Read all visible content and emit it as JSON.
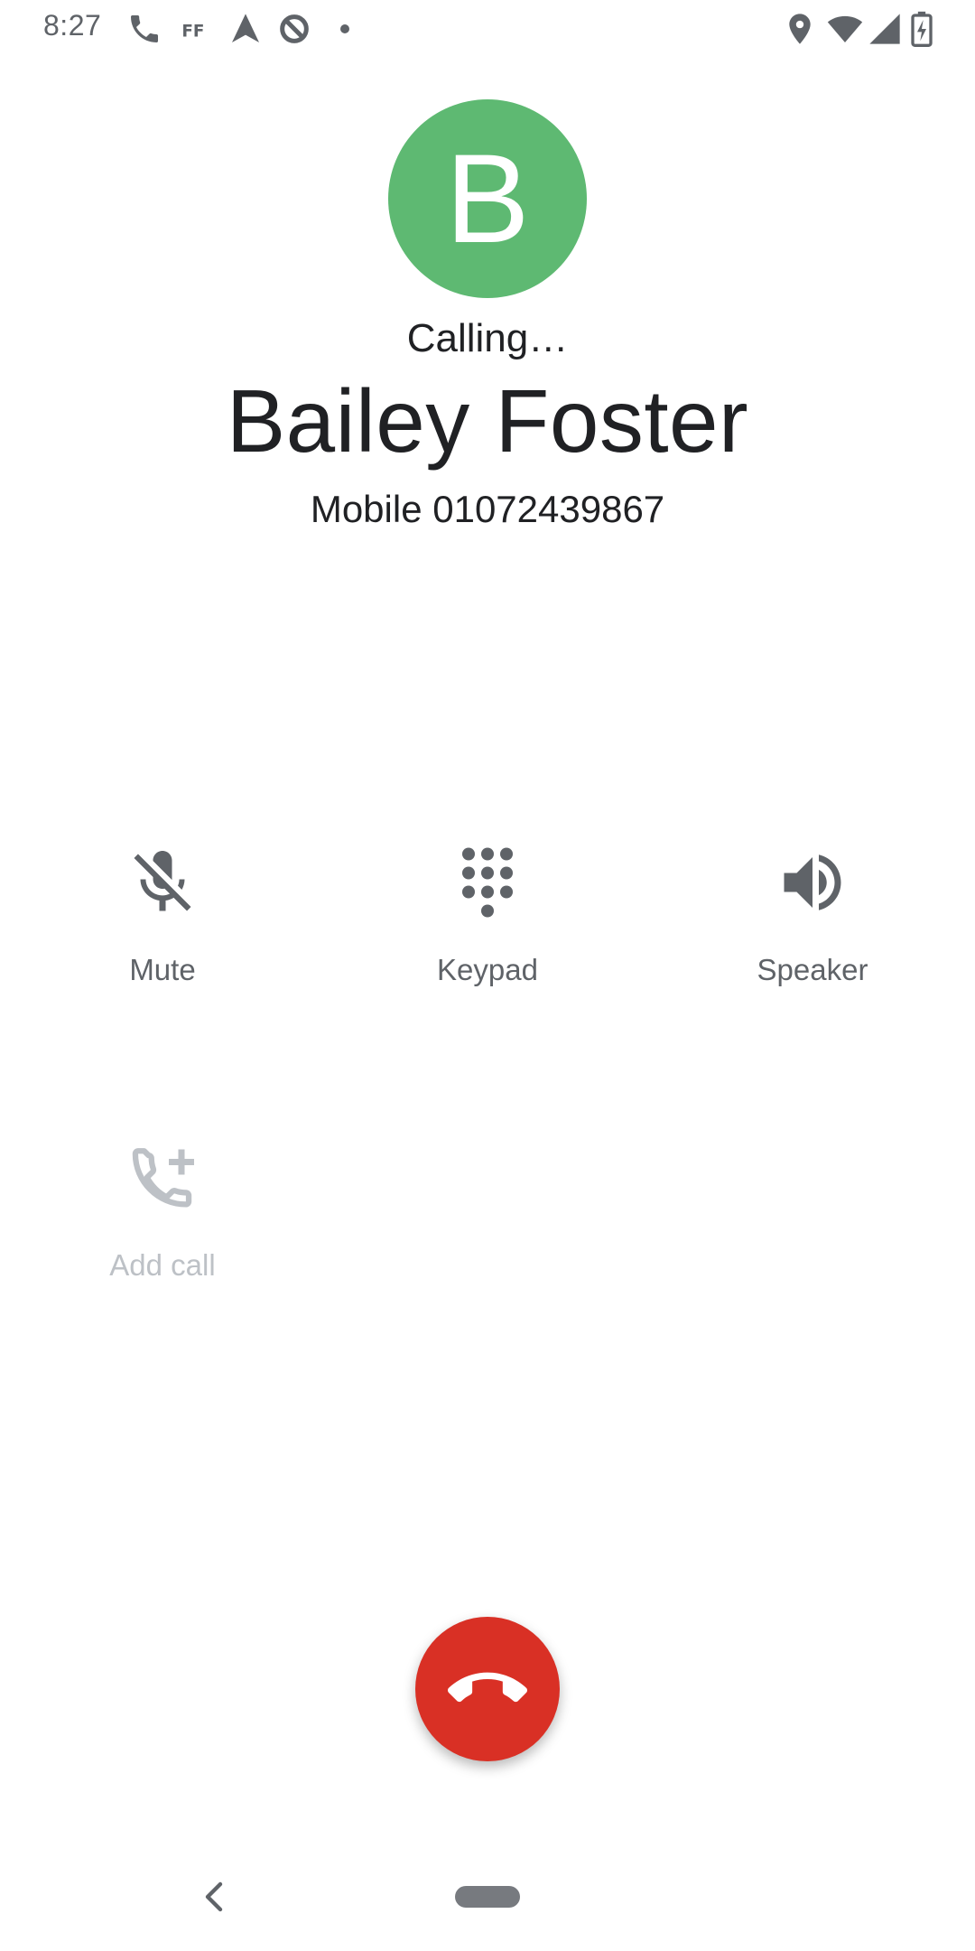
{
  "status_bar": {
    "time": "8:27",
    "left_icons": [
      "phone-icon",
      "ff-icon",
      "navigation-arrow-icon",
      "data-saver-icon",
      "notification-dot-icon"
    ],
    "right_icons": [
      "location-icon",
      "wifi-icon",
      "cell-signal-icon",
      "battery-charging-icon"
    ],
    "ff_text": "FF"
  },
  "caller": {
    "avatar_letter": "B",
    "avatar_color": "#5eb972",
    "status": "Calling…",
    "name": "Bailey Foster",
    "number": "Mobile 01072439867"
  },
  "controls": {
    "mute_label": "Mute",
    "keypad_label": "Keypad",
    "speaker_label": "Speaker",
    "add_call_label": "Add call"
  },
  "end_call": {
    "color": "#d93025"
  },
  "colors": {
    "icon_active": "#5f6368",
    "icon_disabled": "#bdc1c6"
  }
}
